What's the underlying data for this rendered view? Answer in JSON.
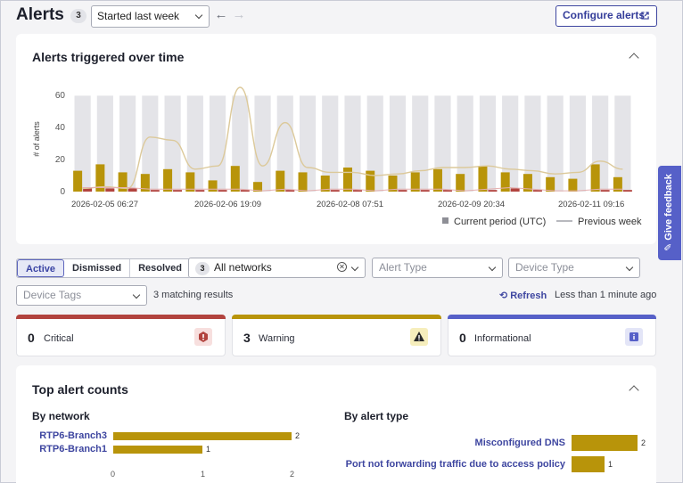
{
  "header": {
    "title": "Alerts",
    "count": "3",
    "timeframe": "Started last week",
    "configure_label": "Configure alerts"
  },
  "chart_card": {
    "title": "Alerts triggered over time"
  },
  "chart_data": {
    "type": "bar",
    "ylabel": "# of alerts",
    "ylim": [
      0,
      65
    ],
    "yticks": [
      0,
      20,
      40,
      60
    ],
    "xtick_labels": [
      "2026-02-05 06:27",
      "2026-02-06 19:09",
      "2026-02-08 07:51",
      "2026-02-09 20:34",
      "2026-02-11 09:16"
    ],
    "legend": {
      "current": "Current period (UTC)",
      "previous": "Previous week",
      "placement": "bottom-right"
    },
    "series": [
      {
        "name": "Current period (UTC)",
        "color": "#b8940a",
        "values": [
          13,
          17,
          12,
          11,
          14,
          12,
          7,
          16,
          6,
          13,
          12,
          10,
          15,
          13,
          10,
          12,
          14,
          11,
          16,
          12,
          11,
          9,
          8,
          17,
          9
        ]
      },
      {
        "name": "Critical",
        "color": "#b2433e",
        "values": [
          2,
          2,
          2,
          1,
          1,
          1,
          1,
          1,
          0,
          1,
          0,
          1,
          1,
          0,
          1,
          1,
          1,
          0,
          1,
          2,
          1,
          0,
          0,
          1,
          1
        ]
      },
      {
        "name": "Previous week",
        "color": "#dcc99a",
        "values": [
          2,
          3,
          2,
          34,
          32,
          14,
          16,
          65,
          16,
          43,
          15,
          12,
          12,
          10,
          11,
          13,
          15,
          15,
          16,
          14,
          13,
          11,
          12,
          19,
          14
        ]
      }
    ]
  },
  "filters": {
    "tabs": [
      "Active",
      "Dismissed",
      "Resolved"
    ],
    "network_count": "3",
    "network_value": "All networks",
    "alert_type_placeholder": "Alert Type",
    "device_type_placeholder": "Device Type",
    "device_tags_placeholder": "Device Tags",
    "matching": "3 matching results",
    "refresh_label": "Refresh",
    "updated": "Less than 1 minute ago"
  },
  "severity": {
    "critical": {
      "count": "0",
      "label": "Critical",
      "color": "#b2433e"
    },
    "warning": {
      "count": "3",
      "label": "Warning",
      "color": "#b8940a"
    },
    "informational": {
      "count": "0",
      "label": "Informational",
      "color": "#5660c8"
    }
  },
  "top_counts": {
    "title": "Top alert counts",
    "by_network": {
      "title": "By network",
      "items": [
        {
          "label": "RTP6-Branch3",
          "value": 2
        },
        {
          "label": "RTP6-Branch1",
          "value": 1
        }
      ],
      "ticks": [
        "0",
        "1",
        "2"
      ]
    },
    "by_type": {
      "title": "By alert type",
      "items": [
        {
          "label": "Misconfigured DNS",
          "value": 2
        },
        {
          "label": "Port not forwarding traffic due to access policy",
          "value": 1
        }
      ]
    }
  },
  "feedback_label": "Give feedback"
}
